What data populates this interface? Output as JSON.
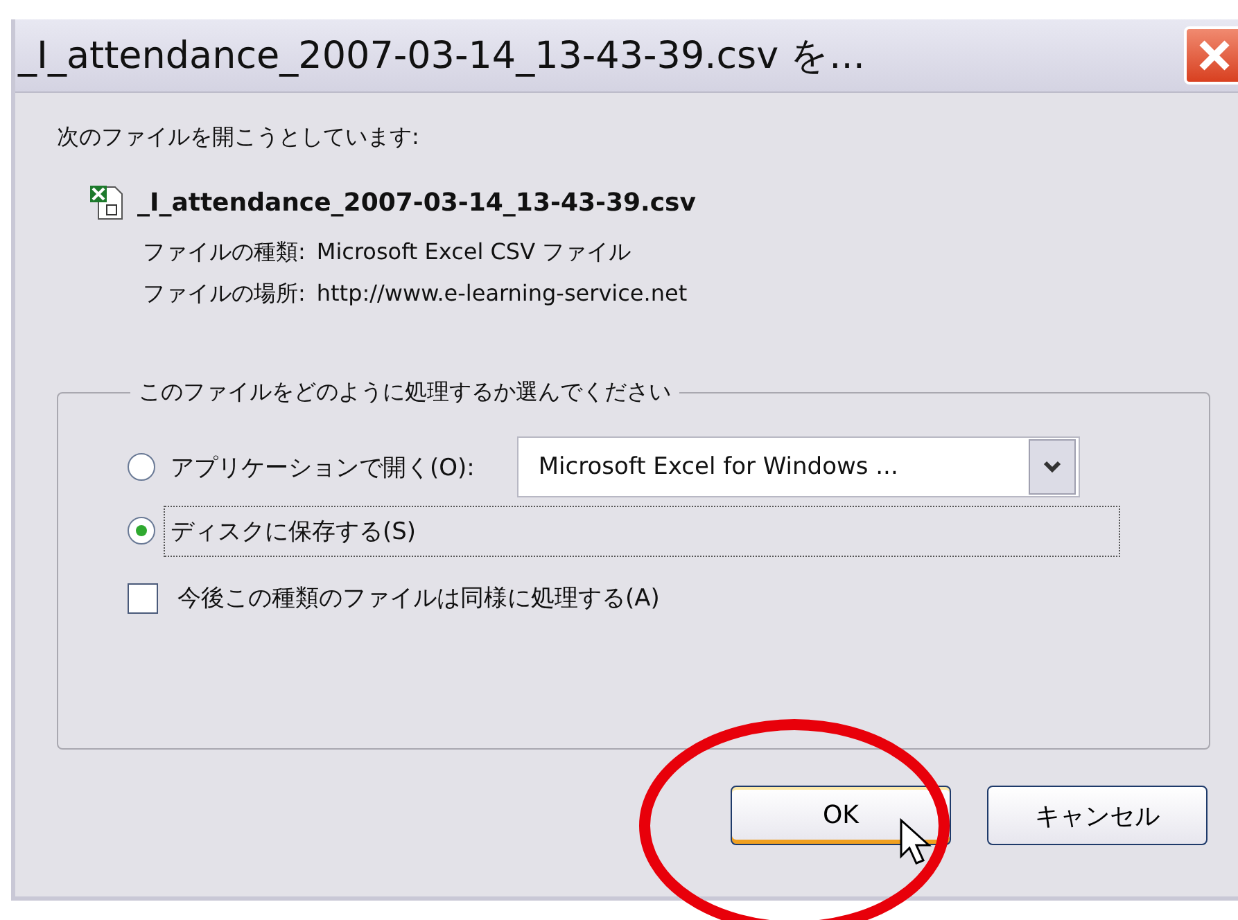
{
  "window": {
    "title": "_I_attendance_2007-03-14_13-43-39.csv を..."
  },
  "intro": "次のファイルを開こうとしています:",
  "file": {
    "name": "_I_attendance_2007-03-14_13-43-39.csv",
    "type_label": "ファイルの種類:",
    "type_value": "Microsoft Excel CSV ファイル",
    "location_label": "ファイルの場所:",
    "location_value": "http://www.e-learning-service.net"
  },
  "group": {
    "legend": "このファイルをどのように処理するか選んでください",
    "options": [
      {
        "kind": "app",
        "label": "アプリケーションで開く(O):",
        "selected": false,
        "dropdown": "Microsoft Excel for Windows ..."
      },
      {
        "kind": "plain",
        "label": "ディスクに保存する(S)",
        "selected": true
      }
    ],
    "checkbox": {
      "label": "今後この種類のファイルは同様に処理する(A)",
      "checked": false
    }
  },
  "buttons": [
    {
      "label": "OK",
      "default": true
    },
    {
      "label": "キャンセル",
      "default": false
    }
  ]
}
